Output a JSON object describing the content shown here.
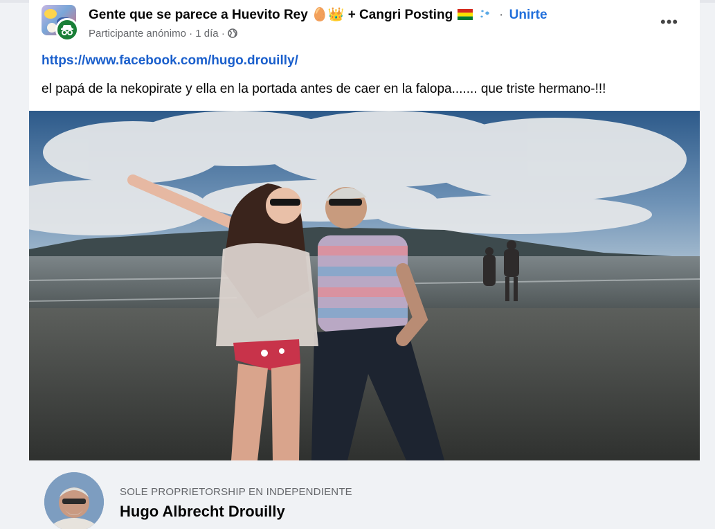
{
  "post": {
    "group_name": "Gente que se parece a Huevito Rey",
    "group_emoji_1": "🥚👑",
    "group_name_suffix": "+ Cangri Posting",
    "separator": "·",
    "join_label": "Unirte",
    "author": "Participante anónimo",
    "time": "1 día",
    "privacy_icon": "globe-icon",
    "more_label": "•••",
    "link_url": "https://www.facebook.com/hugo.drouilly/",
    "text": "el papá de la nekopirate y ella en la portada antes de caer en la falopa....... que triste hermano-!!!"
  },
  "link_preview": {
    "subtitle": "SOLE PROPRIETORSHIP EN INDEPENDIENTE",
    "title": "Hugo Albrecht Drouilly"
  },
  "colors": {
    "link": "#1a5fcc",
    "join": "#216fdb",
    "meta": "#65676b",
    "badge": "#1a7f37"
  }
}
